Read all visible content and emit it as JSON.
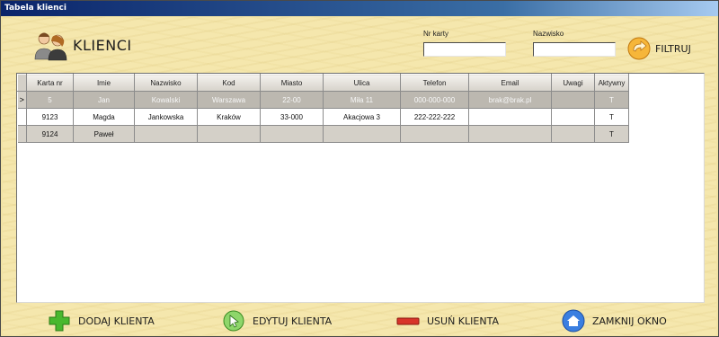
{
  "window": {
    "title": "Tabela klienci"
  },
  "header": {
    "title": "KLIENCI",
    "icon": "users-icon"
  },
  "filters": {
    "card_label": "Nr karty",
    "card_value": "",
    "surname_label": "Nazwisko",
    "surname_value": "",
    "filter_button": "FILTRUJ"
  },
  "table": {
    "columns": [
      "Karta nr",
      "Imie",
      "Nazwisko",
      "Kod",
      "Miasto",
      "Ulica",
      "Telefon",
      "Email",
      "Uwagi",
      "Aktywny"
    ],
    "rows": [
      {
        "indicator": ">",
        "cells": [
          "5",
          "Jan",
          "Kowalski",
          "Warszawa",
          "22-00",
          "Miła 11",
          "000-000-000",
          "brak@brak.pl",
          "",
          "T"
        ]
      },
      {
        "indicator": "",
        "cells": [
          "9123",
          "Magda",
          "Jankowska",
          "Kraków",
          "33-000",
          "Akacjowa 3",
          "222-222-222",
          "",
          "",
          "T"
        ]
      },
      {
        "indicator": "",
        "cells": [
          "9124",
          "Paweł",
          "",
          "",
          "",
          "",
          "",
          "",
          "",
          "T"
        ]
      }
    ]
  },
  "actions": {
    "add": "DODAJ KLIENTA",
    "edit": "EDYTUJ KLIENTA",
    "delete": "USUŃ KLIENTA",
    "close": "ZAMKNIJ OKNO"
  },
  "colors": {
    "accent_title": "#0a246a",
    "add_icon": "#3fae2a",
    "delete_icon": "#d8352a",
    "close_icon": "#2f6fd6",
    "filter_icon": "#f0a020"
  }
}
